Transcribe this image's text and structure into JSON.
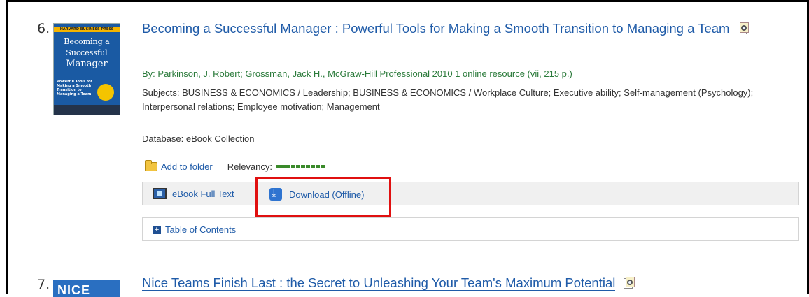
{
  "results": [
    {
      "number": "6.",
      "cover": {
        "band": "HARVARD BUSINESS PRESS",
        "title_lines": [
          "Becoming a",
          "Successful",
          "Manager"
        ],
        "subtitle": "Powerful Tools for Making a Smooth Transition to Managing a Team"
      },
      "title": "Becoming a Successful Manager : Powerful Tools for Making a Smooth Transition to Managing a Team",
      "byline": "By: Parkinson, J. Robert; Grossman, Jack H., McGraw-Hill Professional 2010 1 online resource (vii, 215 p.)",
      "subjects": "Subjects: BUSINESS & ECONOMICS / Leadership; BUSINESS & ECONOMICS / Workplace Culture; Executive ability; Self-management (Psychology); Interpersonal relations; Employee motivation; Management",
      "database": "Database: eBook Collection",
      "add_to_folder": "Add to folder",
      "relevancy_label": "Relevancy:",
      "relevancy_level": 1.0,
      "ebook_full_text": "eBook Full Text",
      "download_offline": "Download (Offline)",
      "table_of_contents": "Table of Contents"
    },
    {
      "number": "7.",
      "cover": {
        "title": "NICE"
      },
      "title": "Nice Teams Finish Last : the Secret to Unleashing Your Team's Maximum Potential"
    }
  ],
  "colors": {
    "link": "#1f5ba8",
    "byline": "#2a7a3a",
    "highlight": "#e01010",
    "relevancy": "#3a8a2a"
  }
}
